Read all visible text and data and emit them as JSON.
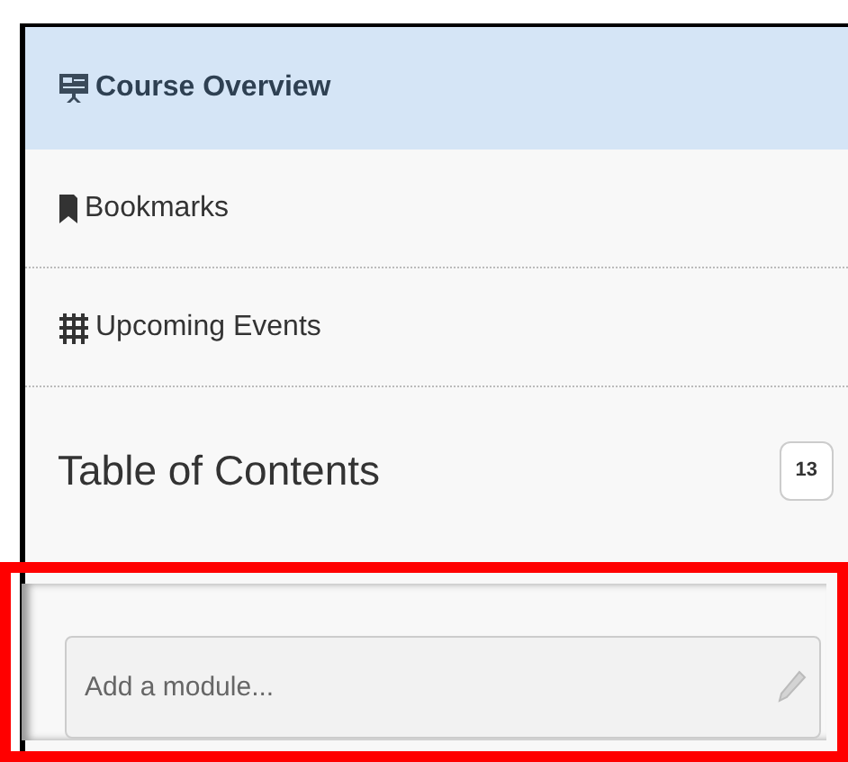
{
  "nav_items": [
    {
      "label": "Course Overview",
      "kind": "presentation",
      "selected": true
    },
    {
      "label": "Bookmarks",
      "kind": "bookmark",
      "selected": false
    },
    {
      "label": "Upcoming Events",
      "kind": "calendar",
      "selected": false
    }
  ],
  "table_of_contents": {
    "title": "Table of Contents",
    "count": "13"
  },
  "add_module": {
    "placeholder": "Add a module...",
    "highlighted": true
  }
}
